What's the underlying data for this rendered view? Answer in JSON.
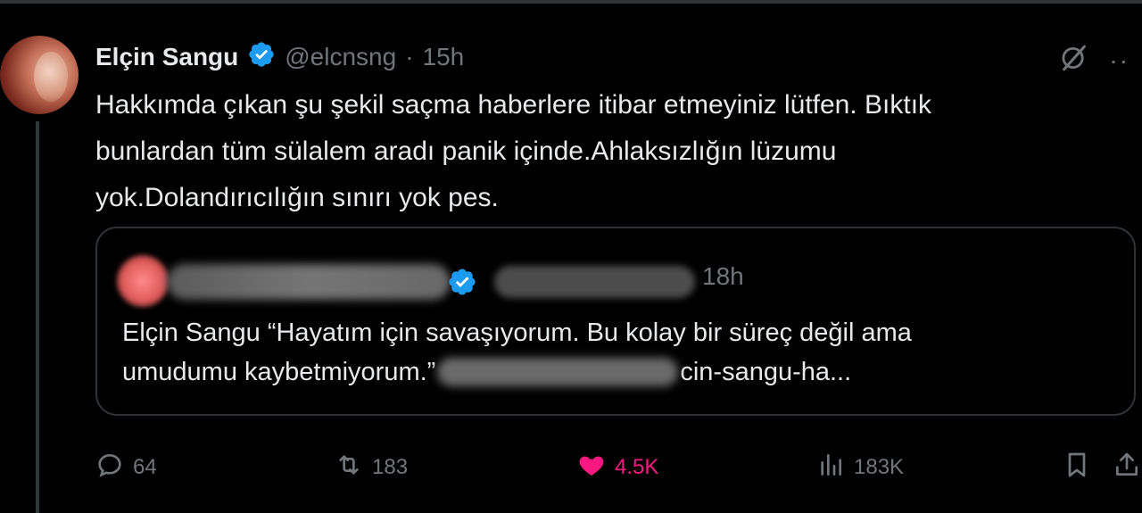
{
  "tweet": {
    "author_name": "Elçin Sangu",
    "handle": "@elcnsng",
    "separator": "·",
    "time": "15h",
    "text": "Hakkımda çıkan şu şekil saçma haberlere itibar etmeyiniz lütfen. Bıktık\nbunlardan tüm sülalem aradı panik içinde.Ahlaksızlığın lüzumu\nyok.Dolandırıcılığın sınırı yok pes.",
    "more_icon": "more-dots-icon",
    "grok_icon": "grok-icon"
  },
  "quote": {
    "time": "18h",
    "text_line1": "Elçin Sangu “Hayatım için savaşıyorum. Bu kolay bir süreç değil ama",
    "text_line2_start": "umudumu kaybetmiyorum.”",
    "text_line2_end": "cin-sangu-ha..."
  },
  "actions": {
    "replies": "64",
    "reposts": "183",
    "likes": "4.5K",
    "views": "183K"
  },
  "colors": {
    "background": "#000000",
    "text": "#e7e9ea",
    "muted": "#71767b",
    "verified": "#1d9bf0",
    "like": "#f91880",
    "border": "#2f3336"
  }
}
